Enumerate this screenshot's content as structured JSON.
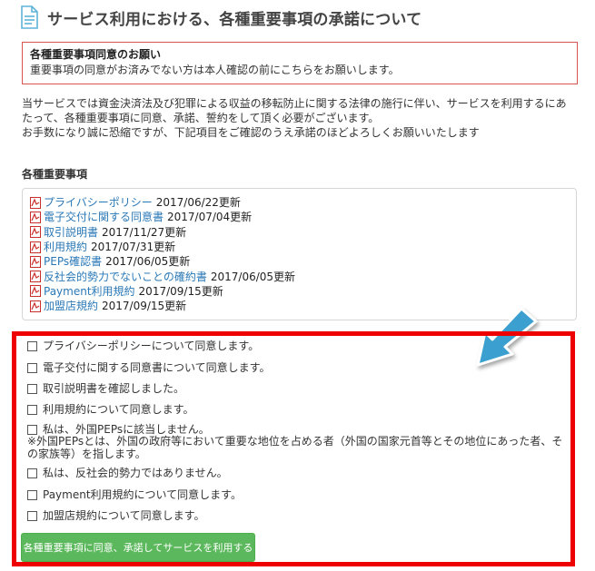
{
  "page": {
    "title": "サービス利用における、各種重要事項の承諾について"
  },
  "notice": {
    "heading": "各種重要事項同意のお願い",
    "text": "重要事項の同意がお済みでない方は本人確認の前にこちらをお願いします。"
  },
  "intro": {
    "line1": "当サービスでは資金決済法及び犯罪による収益の移転防止に関する法律の施行に伴い、サービスを利用するにあ",
    "line2": "たって、各種重要事項に同意、承諾、誓約をして頂く必要がございます。",
    "line3": "お手数になり誠に恐縮ですが、下記項目をご確認のうえ承諾のほどよろしくお願いいたします"
  },
  "documents": {
    "heading": "各種重要事項",
    "items": [
      {
        "label": "プライバシーポリシー",
        "date": "2017/06/22更新"
      },
      {
        "label": "電子交付に関する同意書",
        "date": "2017/07/04更新"
      },
      {
        "label": "取引説明書",
        "date": "2017/11/27更新"
      },
      {
        "label": "利用規約",
        "date": "2017/07/31更新"
      },
      {
        "label": "PEPs確認書",
        "date": "2017/06/05更新"
      },
      {
        "label": "反社会的勢力でないことの確約書",
        "date": "2017/06/05更新"
      },
      {
        "label": "Payment利用規約",
        "date": "2017/09/15更新"
      },
      {
        "label": "加盟店規約",
        "date": "2017/09/15更新"
      }
    ]
  },
  "consents": {
    "items": [
      "プライバシーポリシーについて同意します。",
      "電子交付に関する同意書について同意します。",
      "取引説明書を確認しました。",
      "利用規約について同意します。",
      "私は、外国PEPsに該当しません。",
      "私は、反社会的勢力ではありません。",
      "Payment利用規約について同意します。",
      "加盟店規約について同意します。"
    ],
    "peps_note_line1": "※外国PEPsとは、外国の政府等において重要な地位を占める者（外国の国家元首等とその地位にあった者、そ",
    "peps_note_line2": "の家族等）を指します。",
    "submit_label": "各種重要事項に同意、承諾してサービスを利用する"
  },
  "colors": {
    "link": "#2a78b6",
    "highlight_border": "#ee0000",
    "notice_border": "#d9534f",
    "button": "#5cb85c",
    "arrow": "#3a9fd0"
  }
}
